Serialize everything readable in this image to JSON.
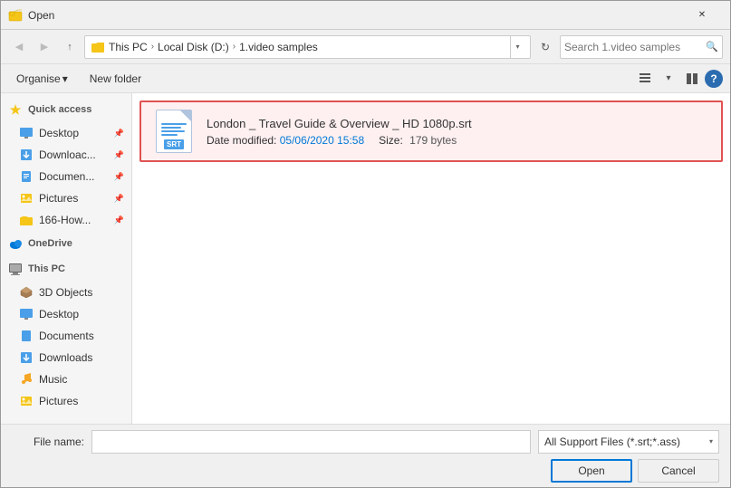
{
  "titlebar": {
    "title": "Open",
    "close_label": "✕"
  },
  "toolbar": {
    "back_btn": "◀",
    "forward_btn": "▶",
    "up_btn": "↑",
    "breadcrumb": {
      "parts": [
        "This PC",
        "Local Disk (D:)",
        "1.video samples"
      ],
      "separator": "›"
    },
    "refresh_btn": "↻",
    "search_placeholder": "Search 1.video samples",
    "search_icon": "🔍"
  },
  "toolbar2": {
    "organise_label": "Organise",
    "organise_arrow": "▾",
    "new_folder_label": "New folder",
    "view_icon1": "≡",
    "view_icon2": "⊟",
    "view_icon3": "⊞",
    "help_icon": "?"
  },
  "sidebar": {
    "sections": [
      {
        "type": "header",
        "icon": "★",
        "label": "Quick access"
      },
      {
        "icon": "🖥",
        "label": "Desktop",
        "pin": true
      },
      {
        "icon": "⬇",
        "label": "Downloac...",
        "pin": true
      },
      {
        "icon": "📄",
        "label": "Documen...",
        "pin": true
      },
      {
        "icon": "🖼",
        "label": "Pictures",
        "pin": true
      },
      {
        "icon": "📁",
        "label": "166-How...",
        "pin": true
      },
      {
        "type": "header",
        "icon": "☁",
        "label": "OneDrive"
      },
      {
        "type": "header",
        "icon": "💻",
        "label": "This PC"
      },
      {
        "icon": "🔷",
        "label": "3D Objects"
      },
      {
        "icon": "🖥",
        "label": "Desktop"
      },
      {
        "icon": "📄",
        "label": "Documents"
      },
      {
        "icon": "⬇",
        "label": "Downloads"
      },
      {
        "icon": "🎵",
        "label": "Music"
      },
      {
        "icon": "🖼",
        "label": "Pictures"
      }
    ]
  },
  "file": {
    "name": "London _ Travel Guide & Overview _ HD 1080p.srt",
    "date_label": "Date modified:",
    "date_value": "05/06/2020 15:58",
    "size_label": "Size:",
    "size_value": "179 bytes",
    "type_label": "SRT"
  },
  "bottom": {
    "filename_label": "File name:",
    "filename_value": "",
    "filetype_label": "All Support Files (*.srt;*.ass)",
    "open_label": "Open",
    "cancel_label": "Cancel"
  }
}
